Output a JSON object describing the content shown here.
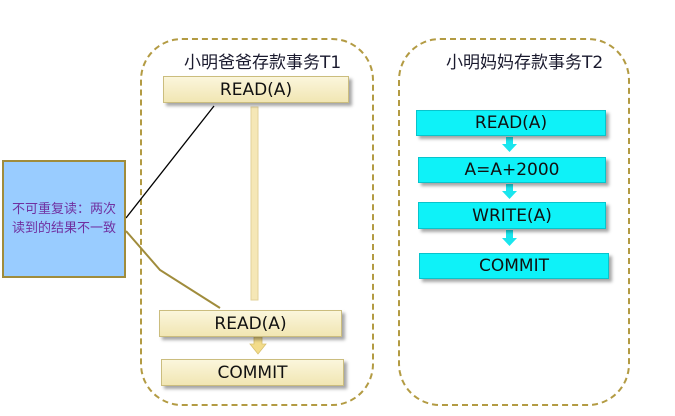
{
  "t1": {
    "title": "小明爸爸存款事务T1",
    "steps": [
      "READ(A)",
      "READ(A)",
      "COMMIT"
    ]
  },
  "t2": {
    "title": "小明妈妈存款事务T2",
    "steps": [
      "READ(A)",
      "A=A+2000",
      "WRITE(A)",
      "COMMIT"
    ]
  },
  "note": {
    "text": "不可重复读：两次读到的结果不一致"
  },
  "colors": {
    "panel_border": "#b39b43",
    "beige_box": "#f5ecc4",
    "cyan_box": "#0ef2f8",
    "note_bg": "#99ccff",
    "note_text": "#7030a0"
  }
}
